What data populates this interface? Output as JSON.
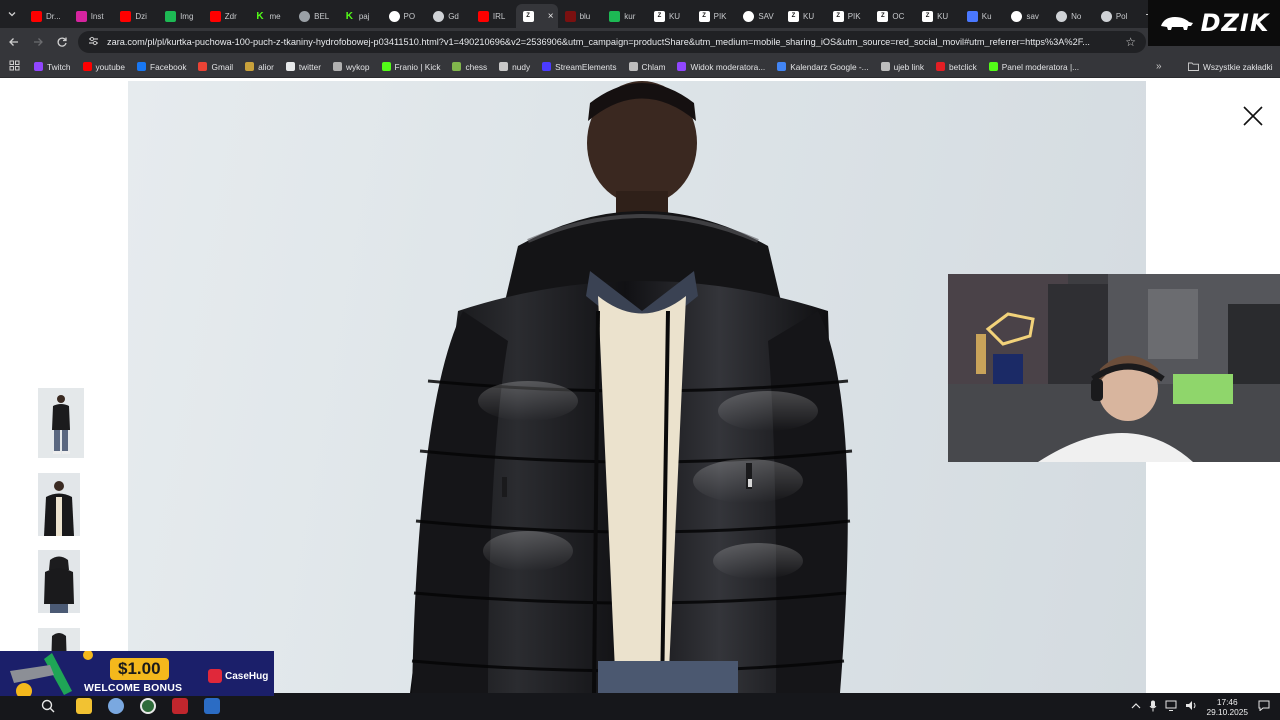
{
  "browser": {
    "tabs": [
      {
        "label": "Dr...",
        "icon": "youtube-icon",
        "color": "#ff0000"
      },
      {
        "label": "Inst",
        "icon": "instagram-icon",
        "color": "#d6249f"
      },
      {
        "label": "Dzi",
        "icon": "youtube-icon",
        "color": "#ff0000"
      },
      {
        "label": "Img",
        "icon": "imgsearch-icon",
        "color": "#1db954"
      },
      {
        "label": "Zdr",
        "icon": "youtube-icon",
        "color": "#ff0000"
      },
      {
        "label": "me",
        "icon": "kick-icon",
        "color": "#53fc18"
      },
      {
        "label": "BEL",
        "icon": "globe-icon",
        "color": "#9aa0a6"
      },
      {
        "label": "paj",
        "icon": "kick-icon",
        "color": "#53fc18"
      },
      {
        "label": "PO",
        "icon": "google-icon",
        "color": "#ffffff"
      },
      {
        "label": "Gd",
        "icon": "chatgpt-icon",
        "color": "#cfd2d6"
      },
      {
        "label": "IRL",
        "icon": "youtube-icon",
        "color": "#ff0000"
      },
      {
        "label": "",
        "icon": "zara-icon",
        "color": "#ffffff",
        "active": true
      },
      {
        "label": "blu",
        "icon": "youtube-icon",
        "color": "#7a1010"
      },
      {
        "label": "kur",
        "icon": "imgsearch-icon",
        "color": "#1db954"
      },
      {
        "label": "KU",
        "icon": "zara-icon",
        "color": "#ffffff"
      },
      {
        "label": "PIK",
        "icon": "zara-icon",
        "color": "#ffffff"
      },
      {
        "label": "SAV",
        "icon": "threads-icon",
        "color": "#ffffff"
      },
      {
        "label": "KU",
        "icon": "zara-icon",
        "color": "#ffffff"
      },
      {
        "label": "PIK",
        "icon": "zara-icon",
        "color": "#ffffff"
      },
      {
        "label": "OC",
        "icon": "zara-icon",
        "color": "#ffffff"
      },
      {
        "label": "KU",
        "icon": "zara-icon",
        "color": "#ffffff"
      },
      {
        "label": "Ku",
        "icon": "re-icon",
        "color": "#4a78ff"
      },
      {
        "label": "sav",
        "icon": "google-icon",
        "color": "#ffffff"
      },
      {
        "label": "No",
        "icon": "chatgpt-icon",
        "color": "#cfd2d6"
      },
      {
        "label": "Pol",
        "icon": "settings-icon",
        "color": "#cfd2d6"
      }
    ],
    "active_tab_close": "×",
    "new_tab_label": "+",
    "url": "zara.com/pl/pl/kurtka-puchowa-100-puch-z-tkaniny-hydrofobowej-p03411510.html?v1=490210696&v2=2536906&utm_campaign=productShare&utm_medium=mobile_sharing_iOS&utm_source=red_social_movil#utm_referrer=https%3A%2F...",
    "bookmarks": [
      {
        "label": "Twitch",
        "color": "#9146ff"
      },
      {
        "label": "youtube",
        "color": "#ff0000"
      },
      {
        "label": "Facebook",
        "color": "#1877f2"
      },
      {
        "label": "Gmail",
        "color": "#ea4335"
      },
      {
        "label": "alior",
        "color": "#c8a13b"
      },
      {
        "label": "twitter",
        "color": "#e7e9ea"
      },
      {
        "label": "wykop",
        "color": "#b0b0b0"
      },
      {
        "label": "Franio | Kick",
        "color": "#53fc18"
      },
      {
        "label": "chess",
        "color": "#81b64c"
      },
      {
        "label": "nudy",
        "color": "#c8c8c8"
      },
      {
        "label": "StreamElements",
        "color": "#4b3bff"
      },
      {
        "label": "Chlam",
        "color": "#bdbdbd"
      },
      {
        "label": "Widok moderatora...",
        "color": "#9146ff"
      },
      {
        "label": "Kalendarz Google -...",
        "color": "#4285f4"
      },
      {
        "label": "ujeb link",
        "color": "#bdbdbd"
      },
      {
        "label": "betclick",
        "color": "#e31e24"
      },
      {
        "label": "Panel moderatora |...",
        "color": "#53fc18"
      }
    ],
    "bookmarks_more": "»",
    "all_bookmarks": "Wszystkie zakładki"
  },
  "stream_overlay": {
    "logo_text": "DZIK",
    "promo": {
      "amount": "$1.00",
      "subtitle": "WELCOME BONUS",
      "brand": "CaseHug"
    }
  },
  "taskbar": {
    "time": "17:46",
    "date": "29.10.2025"
  }
}
